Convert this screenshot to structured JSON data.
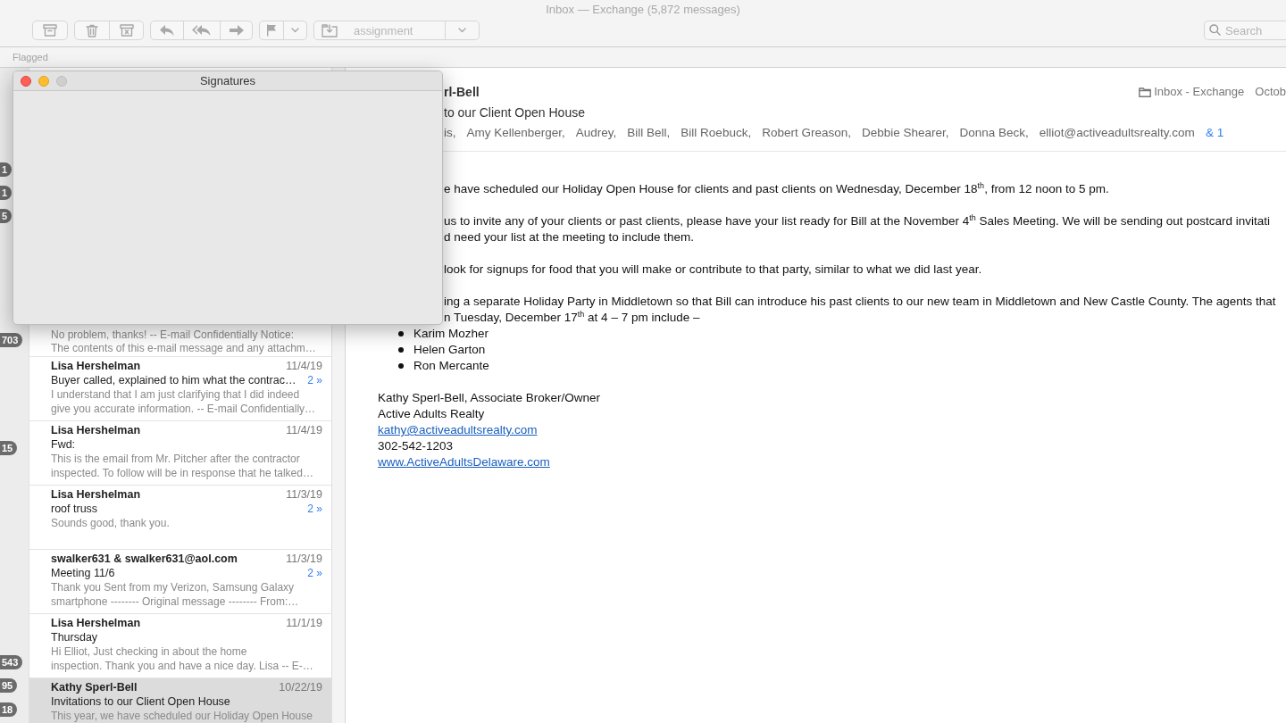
{
  "window": {
    "title": "Inbox — Exchange (5,872 messages)"
  },
  "toolbar": {
    "disabled": true,
    "move_menu": "assignment",
    "search": {
      "placeholder": "Search"
    }
  },
  "favorites_bar": {
    "items": [
      "Flagged"
    ]
  },
  "sidebar": {
    "badges": [
      "1",
      "1",
      "5",
      "703",
      "15",
      "543",
      "95",
      "18"
    ]
  },
  "message_list": [
    {
      "preview": [
        "No problem, thanks! -- E-mail Confidentially Notice:",
        "The contents of this e-mail message and any attachm…"
      ],
      "selected": false
    },
    {
      "from": "Lisa Hershelman",
      "date": "11/4/19",
      "subject": "Buyer called, explained to him what the contrac…",
      "preview": [
        "I understand that I am just clarifying that I did indeed",
        "give you accurate information. -- E-mail Confidentially…"
      ],
      "thread_count": "2 »",
      "selected": false
    },
    {
      "from": "Lisa Hershelman",
      "date": "11/4/19",
      "subject": "Fwd:",
      "preview": [
        "This is the email from Mr. Pitcher after the contractor",
        "inspected. To follow will be in response that he talked…"
      ],
      "selected": false
    },
    {
      "from": "Lisa Hershelman",
      "date": "11/3/19",
      "subject": "roof truss",
      "preview": [
        "Sounds good, thank you."
      ],
      "thread_count": "2 »",
      "selected": false
    },
    {
      "from": "swalker631 & swalker631@aol.com",
      "date": "11/3/19",
      "subject": "Meeting 11/6",
      "preview": [
        "Thank you Sent from my Verizon, Samsung Galaxy",
        "smartphone -------- Original message -------- From:…"
      ],
      "thread_count": "2 »",
      "selected": false
    },
    {
      "from": "Lisa Hershelman",
      "date": "11/1/19",
      "subject": "Thursday",
      "preview": [
        "Hi Elliot, Just checking in about the home",
        "inspection. Thank you and have a nice day. Lisa -- E-…"
      ],
      "selected": false
    },
    {
      "from": "Kathy Sperl-Bell",
      "date": "10/22/19",
      "subject": "Invitations to our Client Open House",
      "preview": [
        "This year, we have scheduled our Holiday Open House"
      ],
      "selected": true
    }
  ],
  "message": {
    "from": "rl-Bell",
    "mailbox": "Inbox - Exchange",
    "date": "Octob",
    "subject": "to our Client Open House",
    "recipients": [
      "is,",
      "Amy Kellenberger,",
      "Audrey,",
      "Bill Bell,",
      "Bill Roebuck,",
      "Robert Greason,",
      "Debbie Shearer,",
      "Donna Beck,",
      "elliot@activeadultsrealty.com"
    ],
    "more_recipients": "& 1",
    "paragraphs": [
      [
        "e have scheduled our Holiday Open House for clients and past clients on Wednesday, December 18$^{th}$, from 12 noon to 5 pm."
      ],
      [
        "us to invite any of your clients or past clients, please have your list ready for Bill at the November 4$^{th}$ Sales Meeting. We will be sending out postcard invitati",
        "d need your list at the meeting to include them."
      ],
      [
        "look for signups for food that you will make or contribute to that party,  similar to what we did last year."
      ],
      [
        "ing a separate Holiday Party in Middletown so that Bill can introduce his past clients to our new team in Middletown and New Castle County. The agents that",
        "n Tuesday, December 17$^{th}$ at 4 – 7 pm include –"
      ]
    ],
    "bullets": [
      "Karim Mozher",
      "Helen Garton",
      "Ron Mercante"
    ],
    "signature": [
      {
        "kind": "text",
        "text": "Kathy Sperl-Bell, Associate Broker/Owner"
      },
      {
        "kind": "text",
        "text": "Active Adults Realty"
      },
      {
        "kind": "link",
        "text": "kathy@activeadultsrealty.com"
      },
      {
        "kind": "text",
        "text": "302-542-1203"
      },
      {
        "kind": "link",
        "text": "www.ActiveAdultsDelaware.com"
      }
    ]
  },
  "signatures_window": {
    "title": "Signatures"
  }
}
